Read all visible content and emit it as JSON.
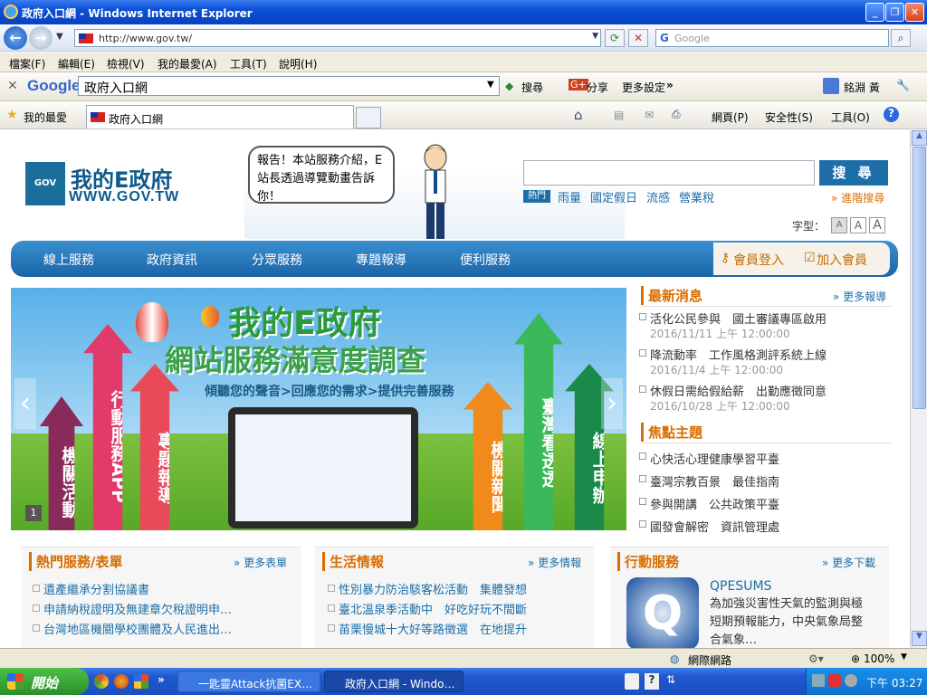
{
  "window": {
    "title": "政府入口網 - Windows Internet Explorer"
  },
  "address": {
    "url": "http://www.gov.tw/",
    "search_placeholder": "Google"
  },
  "menu": [
    "檔案(F)",
    "編輯(E)",
    "檢視(V)",
    "我的最愛(A)",
    "工具(T)",
    "說明(H)"
  ],
  "google_toolbar": {
    "brand": "Google",
    "query": "政府入口網",
    "search_label": "搜尋",
    "share_label": "分享",
    "more_label": "更多設定",
    "user": "銘淵 黃"
  },
  "favbar": {
    "favorites": "我的最愛",
    "tab_title": "政府入口網",
    "page_menu": "網頁(P)",
    "safety_menu": "安全性(S)",
    "tools_menu": "工具(O)"
  },
  "site": {
    "logo_title": "我的E政府",
    "logo_url": "WWW.GOV.TW",
    "logo_mark": "GOV",
    "bubble": "報告！本站服務介紹，E站長透過導覽動畫告訴你！",
    "search_button": "搜 尋",
    "hot_label": "熱門",
    "hot_keywords": [
      "雨量",
      "國定假日",
      "流感",
      "營業稅"
    ],
    "advanced_search": "» 進階搜尋",
    "font_size_label": "字型：",
    "font_sizes": [
      "A",
      "A",
      "A"
    ],
    "nav": [
      "線上服務",
      "政府資訊",
      "分眾服務",
      "專題報導",
      "便利服務"
    ],
    "login": "會員登入",
    "join": "加入會員"
  },
  "banner": {
    "title1": "我的E政府",
    "title2": "網站服務滿意度調查",
    "subtitle": "傾聽您的聲音>回應您的需求>提供完善服務",
    "arrows": [
      "機關活動",
      "行動服務APP",
      "專題報導",
      "機關新聞",
      "臺灣看透透",
      "線上申辦"
    ],
    "page": "1",
    "prev": "‹",
    "next": "›"
  },
  "news": {
    "title": "最新消息",
    "more": "» 更多報導",
    "items": [
      {
        "title": "活化公民參與　國土審議專區啟用",
        "date": "2016/11/11 上午 12:00:00"
      },
      {
        "title": "降流動率　工作風格測評系統上線",
        "date": "2016/11/4 上午 12:00:00"
      },
      {
        "title": "休假日需給假給薪　出勤應徵同意",
        "date": "2016/10/28 上午 12:00:00"
      }
    ]
  },
  "focus": {
    "title": "焦點主題",
    "items": [
      "心快活心理健康學習平臺",
      "臺灣宗教百景　最佳指南",
      "參與開講　公共政策平臺",
      "國發會解密　資訊管理處"
    ]
  },
  "hot_services": {
    "title": "熱門服務/表單",
    "more": "» 更多表單",
    "items": [
      "遺產繼承分割協議書",
      "申請納稅證明及無建章欠稅證明申…",
      "台灣地區機關學校團體及人民進出…"
    ]
  },
  "life": {
    "title": "生活情報",
    "more": "» 更多情報",
    "items": [
      "性別暴力防治駭客松活動　集體發想",
      "臺北溫泉季活動中　好吃好玩不間斷",
      "苗栗慢城十大好等路徵選　在地提升"
    ]
  },
  "mobile": {
    "title": "行動服務",
    "more": "» 更多下載",
    "app_name": "QPESUMS",
    "app_icon_letter": "Q",
    "app_desc": "為加強災害性天氣的監測與極短期預報能力，中央氣象局整合氣象…"
  },
  "status": {
    "zone": "網際網路",
    "zoom": "100%"
  },
  "taskbar": {
    "start": "開始",
    "items": [
      "一匙靈Attack抗菌EX…",
      "政府入口網 - Windo…"
    ],
    "clock": "下午 03:27"
  }
}
